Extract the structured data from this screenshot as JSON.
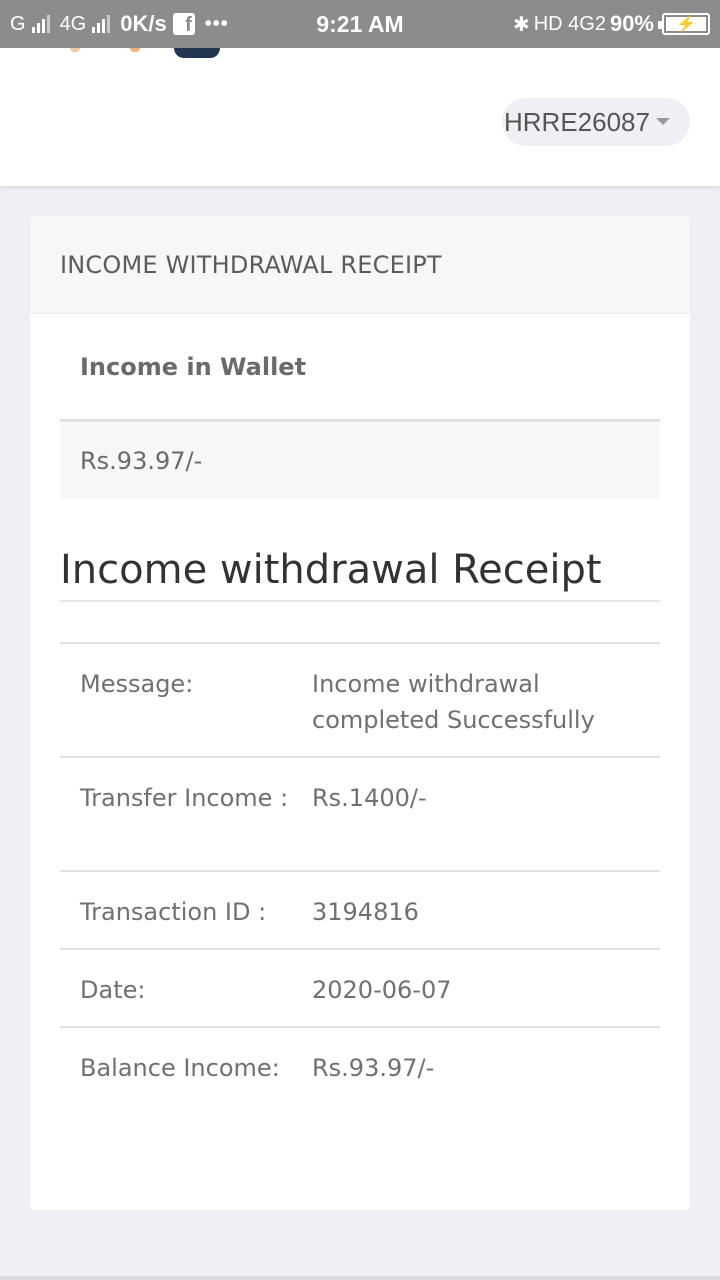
{
  "status_bar": {
    "network_1": "G",
    "network_2": "4G",
    "speed": "0K/s",
    "fb_glyph": "f",
    "dots": "•••",
    "time": "9:21 AM",
    "bluetooth_glyph": "✱",
    "right_network": "HD 4G2",
    "battery_percent": "90%",
    "bolt_glyph": "⚡"
  },
  "header": {
    "user_id": "HRRE26087"
  },
  "card": {
    "header_title": "INCOME WITHDRAWAL RECEIPT",
    "wallet_label": "Income in Wallet",
    "wallet_value": "Rs.93.97/-",
    "receipt_title": "Income withdrawal Receipt",
    "rows": [
      {
        "label": "Message:",
        "value": "Income withdrawal completed Successfully"
      },
      {
        "label": "Transfer Income :",
        "value": "Rs.1400/-"
      },
      {
        "label": "Transaction ID :",
        "value": "3194816"
      },
      {
        "label": "Date:",
        "value": "2020-06-07"
      },
      {
        "label": "Balance Income:",
        "value": "Rs.93.97/-"
      }
    ]
  }
}
